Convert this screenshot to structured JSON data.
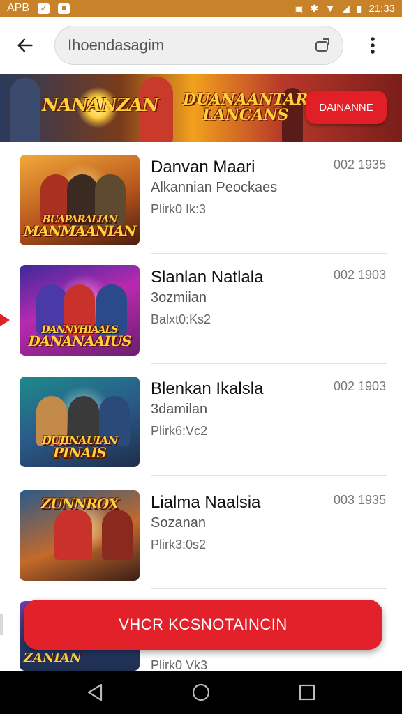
{
  "status_bar": {
    "left_text": "APB",
    "time": "21:33"
  },
  "search": {
    "placeholder": "Ihoendasagim"
  },
  "banner": {
    "title_left": "NANANZAN",
    "title_right_line1": "DUANAANTAR",
    "title_right_line2": "LANCANS",
    "cta_label": "DAINANNE"
  },
  "items": [
    {
      "title": "Danvan Maari",
      "subtitle": "Alkannian Peockaes",
      "meta": "Plirk0 Ik:3",
      "date": "002 1935",
      "thumb_label": "MANMAANIAN",
      "thumb_label_top": "BUAPARALIAN"
    },
    {
      "title": "Slanlan Natlala",
      "subtitle": "3ozmiian",
      "meta": "Balxt0:Ks2",
      "date": "002 1903",
      "thumb_label": "DANANAAIUS",
      "thumb_label_top": "DANNYHIAALS"
    },
    {
      "title": "Blenkan Ikalsla",
      "subtitle": "3damilan",
      "meta": "Plirk6:Vc2",
      "date": "002 1903",
      "thumb_label": "PINAIS",
      "thumb_label_top": "DUIINAUIAN"
    },
    {
      "title": "Lialma Naalsia",
      "subtitle": "Sozanan",
      "meta": "Plirk3:0s2",
      "date": "003 1935",
      "thumb_label": "ZUNNROX",
      "thumb_label_top": "ZUNNROX"
    }
  ],
  "partial_item": {
    "meta": "Plirk0 Vk3",
    "thumb_label": "ZANIAN"
  },
  "fab": {
    "label": "VHCR KCSNOTAINCIN"
  },
  "colors": {
    "accent": "#e3212a",
    "status_bar": "#c8822a"
  }
}
